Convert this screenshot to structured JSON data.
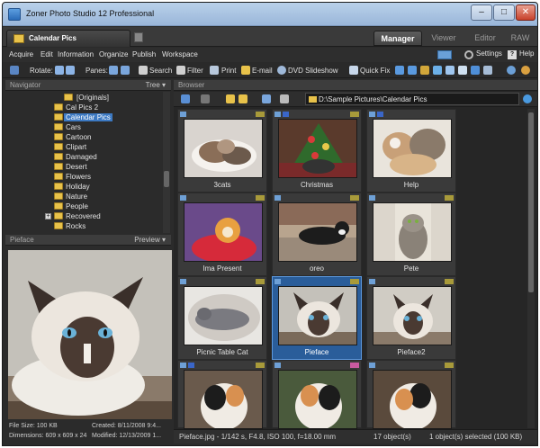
{
  "window": {
    "title": "Zoner Photo Studio 12 Professional"
  },
  "tabs": {
    "document": "Calendar Pics"
  },
  "modules": [
    "Manager",
    "Viewer",
    "Editor",
    "RAW"
  ],
  "menu": {
    "items": [
      "Acquire",
      "Edit",
      "Information",
      "Organize",
      "Publish",
      "Workspace"
    ],
    "settings": "Settings",
    "help": "Help"
  },
  "toolbar": {
    "rotate": "Rotate:",
    "panes": "Panes:",
    "search": "Search",
    "filter": "Filter",
    "print": "Print",
    "email": "E-mail",
    "dvd": "DVD Slideshow",
    "quickfix": "Quick Fix"
  },
  "navigator": {
    "title": "Navigator",
    "mode": "Tree ▾",
    "items": [
      "[Originals]",
      "Cal Pics 2",
      "Calendar Pics",
      "Cars",
      "Cartoon",
      "Clipart",
      "Damaged",
      "Desert",
      "Flowers",
      "Holiday",
      "Nature",
      "People",
      "Recovered",
      "Rocks"
    ]
  },
  "preview": {
    "title": "Pieface",
    "mode": "Preview ▾",
    "file_size": "File Size: 100 KB",
    "created": "Created: 8/11/2008 9:4...",
    "dimensions": "Dimensions: 609 x 609 x 24",
    "modified": "Modified: 12/13/2009 1..."
  },
  "browser": {
    "title": "Browser",
    "path": "D:\\Sample Pictures\\Calendar Pics",
    "thumbnails": [
      "3cats",
      "Christmas",
      "Help",
      "Ima Present",
      "oreo",
      "Pete",
      "Picnic Table Cat",
      "Pieface",
      "Pieface2",
      "",
      "",
      ""
    ]
  },
  "status": {
    "info": "Pieface.jpg - 1/142 s, F4.8, ISO 100, f=18.00 mm",
    "count": "17 object(s)",
    "selected": "1 object(s) selected (100 KB)"
  }
}
